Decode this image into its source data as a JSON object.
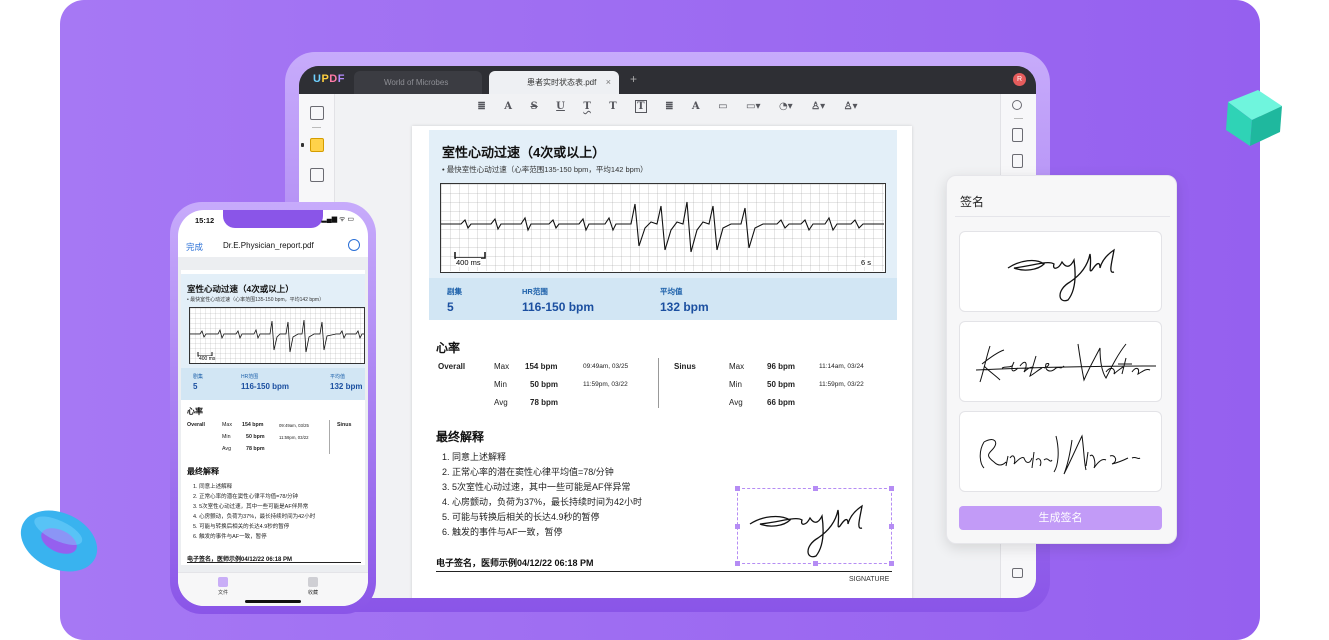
{
  "tablet": {
    "logo": "UPDF",
    "tabs": [
      {
        "label": "World of Microbes",
        "close": ""
      },
      {
        "label": "患者实时状态表.pdf",
        "close": "×"
      }
    ],
    "add_tab": "+",
    "avatar": "R",
    "toolbar_glyphs": [
      "≣",
      "A",
      "S",
      "U",
      "T",
      "T",
      "T",
      "≣",
      "A",
      "▭",
      "▭▾",
      "◔▾",
      "♙▾",
      "♙▾"
    ]
  },
  "document": {
    "title": "室性心动过速（4次或以上）",
    "subtitle": "•  最快室性心动过速（心率范围135-150 bpm，平均142 bpm）",
    "ecg_scale": "400 ms",
    "ecg_duration": "6 s",
    "stats": [
      {
        "label": "剧集",
        "value": "5"
      },
      {
        "label": "HR范围",
        "value": "116-150 bpm"
      },
      {
        "label": "平均值",
        "value": "132 bpm"
      }
    ],
    "heart_rate_heading": "心率",
    "overall": {
      "label": "Overall",
      "rows": [
        {
          "k": "Max",
          "v": "154 bpm",
          "t": "09:49am, 03/25"
        },
        {
          "k": "Min",
          "v": "50 bpm",
          "t": "11:59pm, 03/22"
        },
        {
          "k": "Avg",
          "v": "78 bpm",
          "t": ""
        }
      ]
    },
    "sinus": {
      "label": "Sinus",
      "rows": [
        {
          "k": "Max",
          "v": "96 bpm",
          "t": "11:14am, 03/24"
        },
        {
          "k": "Min",
          "v": "50 bpm",
          "t": "11:59pm, 03/22"
        },
        {
          "k": "Avg",
          "v": "66 bpm",
          "t": ""
        }
      ]
    },
    "final_heading": "最终解释",
    "items": [
      "1. 同意上述解释",
      "2. 正常心率的潜在窦性心律平均值=78/分钟",
      "3. 5次室性心动过速，其中一些可能是AF伴异常",
      "4. 心房颤动，负荷为37%，最长持续时间为42小时",
      "5. 可能与转换后相关的长达4.9秒的暂停",
      "6. 触发的事件与AF一致，暂停"
    ],
    "signature_footer": "电子签名，医师示例04/12/22 06:18 PM",
    "signature_label": "SIGNATURE"
  },
  "signature_panel": {
    "title": "签名",
    "signatures": [
      "signature-1",
      "Kristen Watson",
      "Richard Nixon"
    ],
    "generate_button": "生成签名"
  },
  "phone": {
    "time": "15:12",
    "status": "▂▄▆ ᯤ ▭",
    "done": "完成",
    "filename": "Dr.E.Physician_report.pdf",
    "title": "室性心动过速（4次或以上）",
    "subtitle": "•  最快室性心动过速（心率范围135-150 bpm，平均142 bpm）",
    "ecg_scale": "400 ms",
    "stats": [
      {
        "label": "剧集",
        "value": "5"
      },
      {
        "label": "HR范围",
        "value": "116-150 bpm"
      },
      {
        "label": "平均值",
        "value": "132 bpm"
      }
    ],
    "heart_rate_heading": "心率",
    "overall_label": "Overall",
    "rows": [
      {
        "k": "Max",
        "v": "154 bpm",
        "t": "09:49am, 03/25"
      },
      {
        "k": "Min",
        "v": "50 bpm",
        "t": "11:59pm, 03/22"
      },
      {
        "k": "Avg",
        "v": "78 bpm",
        "t": ""
      }
    ],
    "sinus_label": "Sinus",
    "final_heading": "最终解释",
    "items": [
      "1. 同意上述解释",
      "2. 正常心率的潜在窦性心律平均值=78/分钟",
      "3. 5次室性心动过速，其中一些可能是AF伴异常",
      "4. 心房颤动，负荷为37%，最长持续时间为42小时",
      "5. 可能与转换后相关的长达4.9秒的暂停",
      "6. 触发的事件与AF一致，暂停"
    ],
    "signature_footer": "电子签名，医师示例04/12/22 06:18 PM",
    "tab_files": "文件",
    "tab_favorites": "收藏"
  }
}
